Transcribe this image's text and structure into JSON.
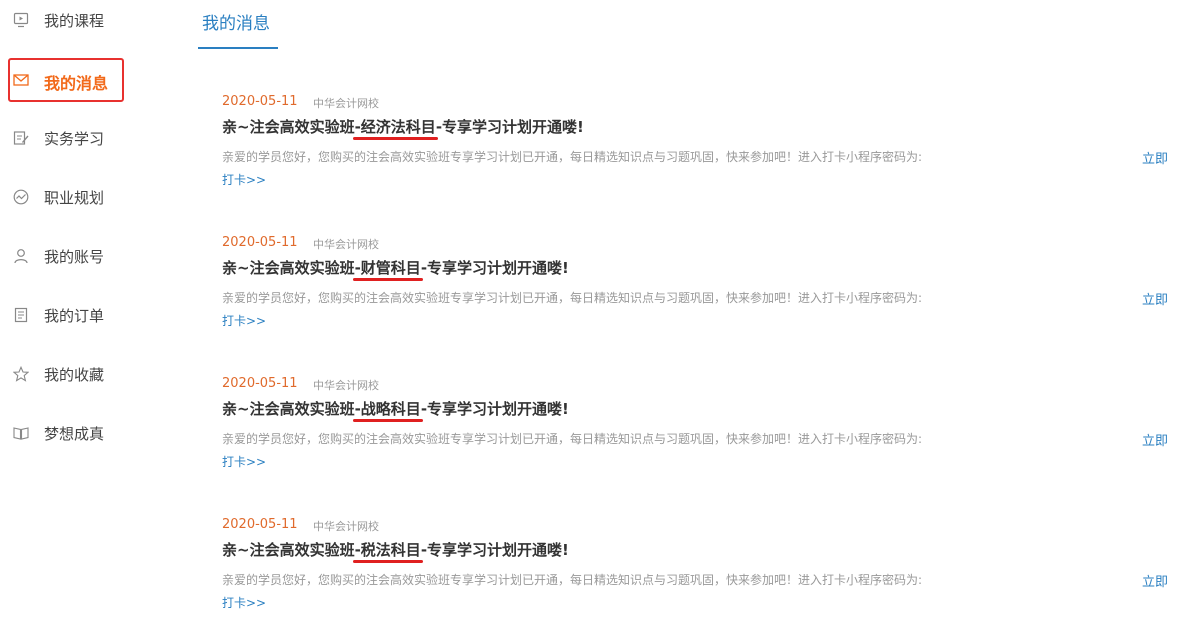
{
  "sidebar": {
    "items": [
      {
        "label": "我的课程",
        "icon": "course-icon"
      },
      {
        "label": "我的消息",
        "icon": "mail-icon",
        "active": true
      },
      {
        "label": "实务学习",
        "icon": "edit-icon"
      },
      {
        "label": "职业规划",
        "icon": "chart-icon"
      },
      {
        "label": "我的账号",
        "icon": "user-icon"
      },
      {
        "label": "我的订单",
        "icon": "order-icon"
      },
      {
        "label": "我的收藏",
        "icon": "star-icon"
      },
      {
        "label": "梦想成真",
        "icon": "book-icon"
      }
    ]
  },
  "tab": {
    "label": "我的消息"
  },
  "messages": [
    {
      "date": "2020-05-11",
      "source": "中华会计网校",
      "title_prefix": "亲~注会高效实验班",
      "title_highlight": "-经济法科目",
      "title_suffix": "-专享学习计划开通喽!",
      "body": "亲爱的学员您好，您购买的注会高效实验班专享学习计划已开通，每日精选知识点与习题巩固，快来参加吧！进入打卡小程序密码为:",
      "link_a": "立即",
      "link_b": "打卡>>"
    },
    {
      "date": "2020-05-11",
      "source": "中华会计网校",
      "title_prefix": "亲~注会高效实验班",
      "title_highlight": "-财管科目",
      "title_suffix": "-专享学习计划开通喽!",
      "body": "亲爱的学员您好，您购买的注会高效实验班专享学习计划已开通，每日精选知识点与习题巩固，快来参加吧！进入打卡小程序密码为:",
      "link_a": "立即",
      "link_b": "打卡>>"
    },
    {
      "date": "2020-05-11",
      "source": "中华会计网校",
      "title_prefix": "亲~注会高效实验班",
      "title_highlight": "-战略科目",
      "title_suffix": "-专享学习计划开通喽!",
      "body": "亲爱的学员您好，您购买的注会高效实验班专享学习计划已开通，每日精选知识点与习题巩固，快来参加吧！进入打卡小程序密码为:",
      "link_a": "立即",
      "link_b": "打卡>>"
    },
    {
      "date": "2020-05-11",
      "source": "中华会计网校",
      "title_prefix": "亲~注会高效实验班",
      "title_highlight": "-税法科目",
      "title_suffix": "-专享学习计划开通喽!",
      "body": "亲爱的学员您好，您购买的注会高效实验班专享学习计划已开通，每日精选知识点与习题巩固，快来参加吧！进入打卡小程序密码为:",
      "link_a": "立即",
      "link_b": "打卡>>"
    }
  ],
  "colors": {
    "accent_blue": "#2a7fc1",
    "active_orange": "#f26a1b",
    "date_orange": "#e06a2c",
    "highlight_red": "#e02020"
  }
}
